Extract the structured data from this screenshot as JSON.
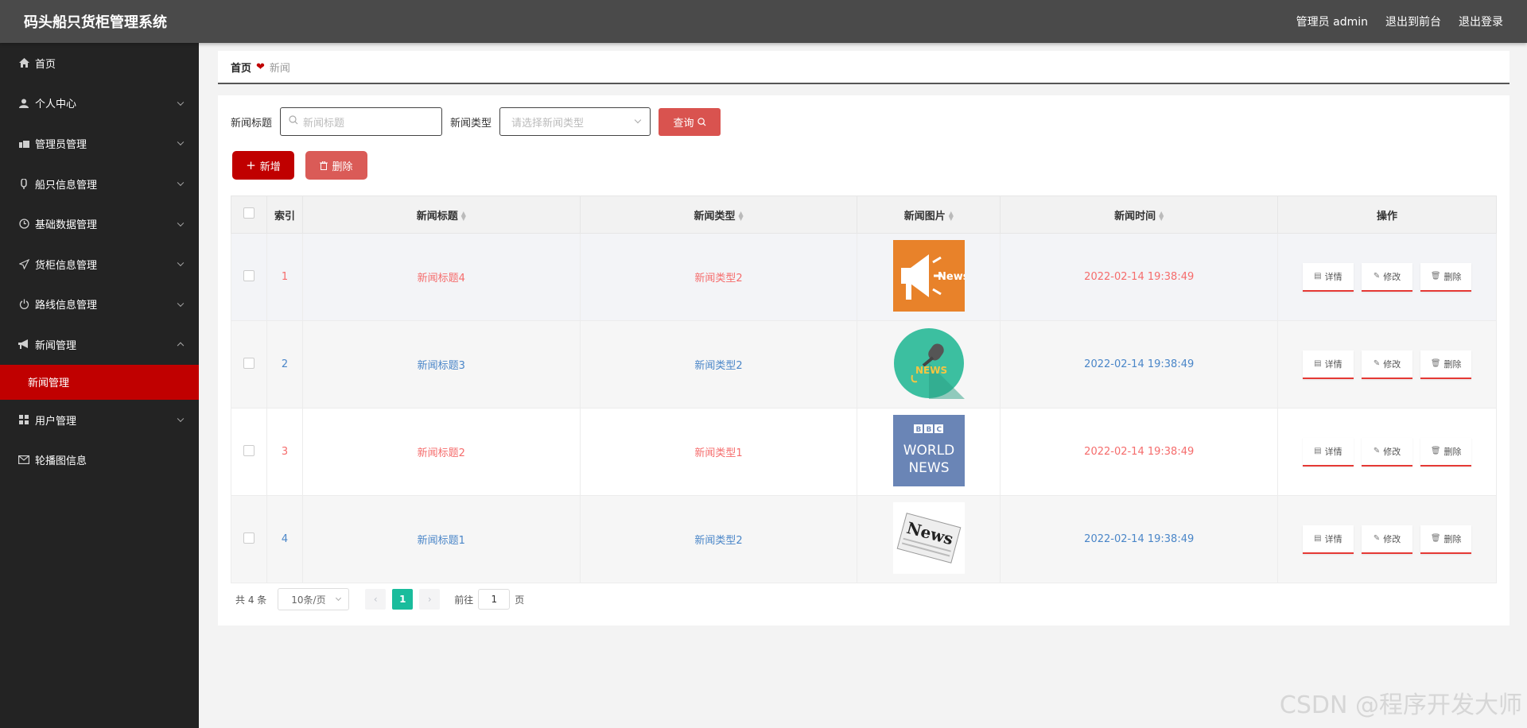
{
  "header": {
    "title": "码头船只货柜管理系统",
    "user": "管理员 admin",
    "front": "退出到前台",
    "logout": "退出登录"
  },
  "sidebar": {
    "items": [
      {
        "label": "首页",
        "icon": "home-icon"
      },
      {
        "label": "个人中心",
        "icon": "user-icon"
      },
      {
        "label": "管理员管理",
        "icon": "admin-icon"
      },
      {
        "label": "船只信息管理",
        "icon": "ship-icon"
      },
      {
        "label": "基础数据管理",
        "icon": "clock-icon"
      },
      {
        "label": "货柜信息管理",
        "icon": "send-icon"
      },
      {
        "label": "路线信息管理",
        "icon": "power-icon"
      },
      {
        "label": "新闻管理",
        "icon": "megaphone-icon"
      },
      {
        "label": "用户管理",
        "icon": "grid-icon"
      },
      {
        "label": "轮播图信息",
        "icon": "mail-icon"
      }
    ],
    "sub_active": "新闻管理"
  },
  "breadcrumb": {
    "home": "首页",
    "current": "新闻"
  },
  "search": {
    "title_label": "新闻标题",
    "title_placeholder": "新闻标题",
    "type_label": "新闻类型",
    "type_placeholder": "请选择新闻类型",
    "query_label": "查询"
  },
  "actions": {
    "add": "新增",
    "delete": "删除"
  },
  "table": {
    "headers": [
      "索引",
      "新闻标题",
      "新闻类型",
      "新闻图片",
      "新闻时间",
      "操作"
    ],
    "rows": [
      {
        "index": "1",
        "title": "新闻标题4",
        "type": "新闻类型2",
        "image": "news-megaphone",
        "time": "2022-02-14 19:38:49",
        "color": "red"
      },
      {
        "index": "2",
        "title": "新闻标题3",
        "type": "新闻类型2",
        "image": "news-microphone",
        "time": "2022-02-14 19:38:49",
        "color": "blue"
      },
      {
        "index": "3",
        "title": "新闻标题2",
        "type": "新闻类型1",
        "image": "bbc-world-news",
        "time": "2022-02-14 19:38:49",
        "color": "red"
      },
      {
        "index": "4",
        "title": "新闻标题1",
        "type": "新闻类型2",
        "image": "news-paper",
        "time": "2022-02-14 19:38:49",
        "color": "blue"
      }
    ],
    "op_detail": "详情",
    "op_edit": "修改",
    "op_delete": "删除"
  },
  "pagination": {
    "total": "共 4 条",
    "page_size": "10条/页",
    "current": "1",
    "goto_label": "前往",
    "goto_value": "1",
    "page_unit": "页"
  },
  "watermark": "CSDN @程序开发大师",
  "colors": {
    "accent": "#c00000",
    "sidebar": "#232323",
    "topbar": "#4a4a4a",
    "active_page": "#1abc9c"
  }
}
